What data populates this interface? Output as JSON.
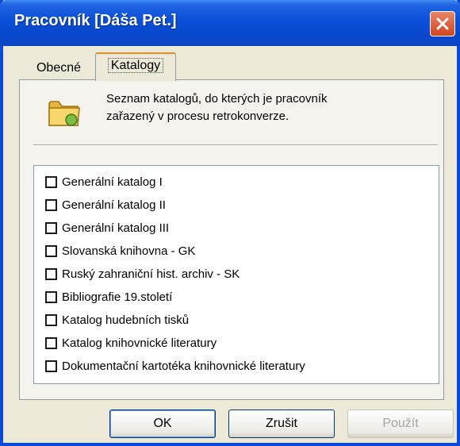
{
  "window": {
    "title": "Pracovník [Dáša Pet.]"
  },
  "tabs": [
    {
      "label": "Obecné"
    },
    {
      "label": "Katalogy"
    }
  ],
  "description": {
    "line1": "Seznam katalogů, do kterých je pracovník",
    "line2": "zařazený v procesu retrokonverze."
  },
  "catalogs": [
    {
      "label": "Generální katalog I",
      "checked": false
    },
    {
      "label": "Generální katalog II",
      "checked": false
    },
    {
      "label": "Generální katalog III",
      "checked": false
    },
    {
      "label": "Slovanská knihovna - GK",
      "checked": false
    },
    {
      "label": "Ruský zahraniční hist. archiv - SK",
      "checked": false
    },
    {
      "label": "Bibliografie 19.století",
      "checked": false
    },
    {
      "label": "Katalog hudebních tisků",
      "checked": false
    },
    {
      "label": "Katalog knihovnické literatury",
      "checked": false
    },
    {
      "label": "Dokumentační kartotéka knihovnické literatury",
      "checked": false
    }
  ],
  "buttons": {
    "ok": "OK",
    "cancel": "Zrušit",
    "apply": "Použít"
  },
  "icons": {
    "close": "close-icon",
    "folder": "folder-icon"
  },
  "colors": {
    "titlebar": "#0a50d8",
    "close": "#d2451f",
    "window_bg": "#ece9d8"
  }
}
